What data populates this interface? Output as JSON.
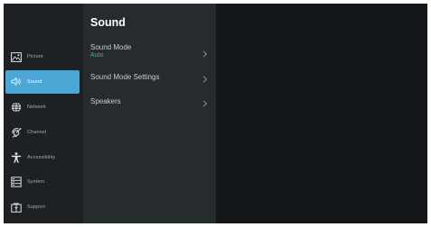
{
  "sidebar": {
    "items": [
      {
        "label": "Picture",
        "icon": "picture-icon",
        "active": false
      },
      {
        "label": "Sound",
        "icon": "sound-icon",
        "active": true
      },
      {
        "label": "Network",
        "icon": "network-icon",
        "active": false
      },
      {
        "label": "Channel",
        "icon": "channel-icon",
        "active": false
      },
      {
        "label": "Accessibility",
        "icon": "accessibility-icon",
        "active": false
      },
      {
        "label": "System",
        "icon": "system-icon",
        "active": false
      },
      {
        "label": "Support",
        "icon": "support-icon",
        "active": false
      }
    ]
  },
  "panel": {
    "title": "Sound",
    "items": [
      {
        "label": "Sound Mode",
        "value": "Auto"
      },
      {
        "label": "Sound Mode Settings",
        "value": ""
      },
      {
        "label": "Speakers",
        "value": ""
      }
    ]
  },
  "colors": {
    "accent": "#4ba7d6",
    "value_text": "#35b4b0",
    "sidebar_bg": "#1d2124",
    "panel_bg": "#262b2e",
    "screen_bg": "#131618"
  }
}
